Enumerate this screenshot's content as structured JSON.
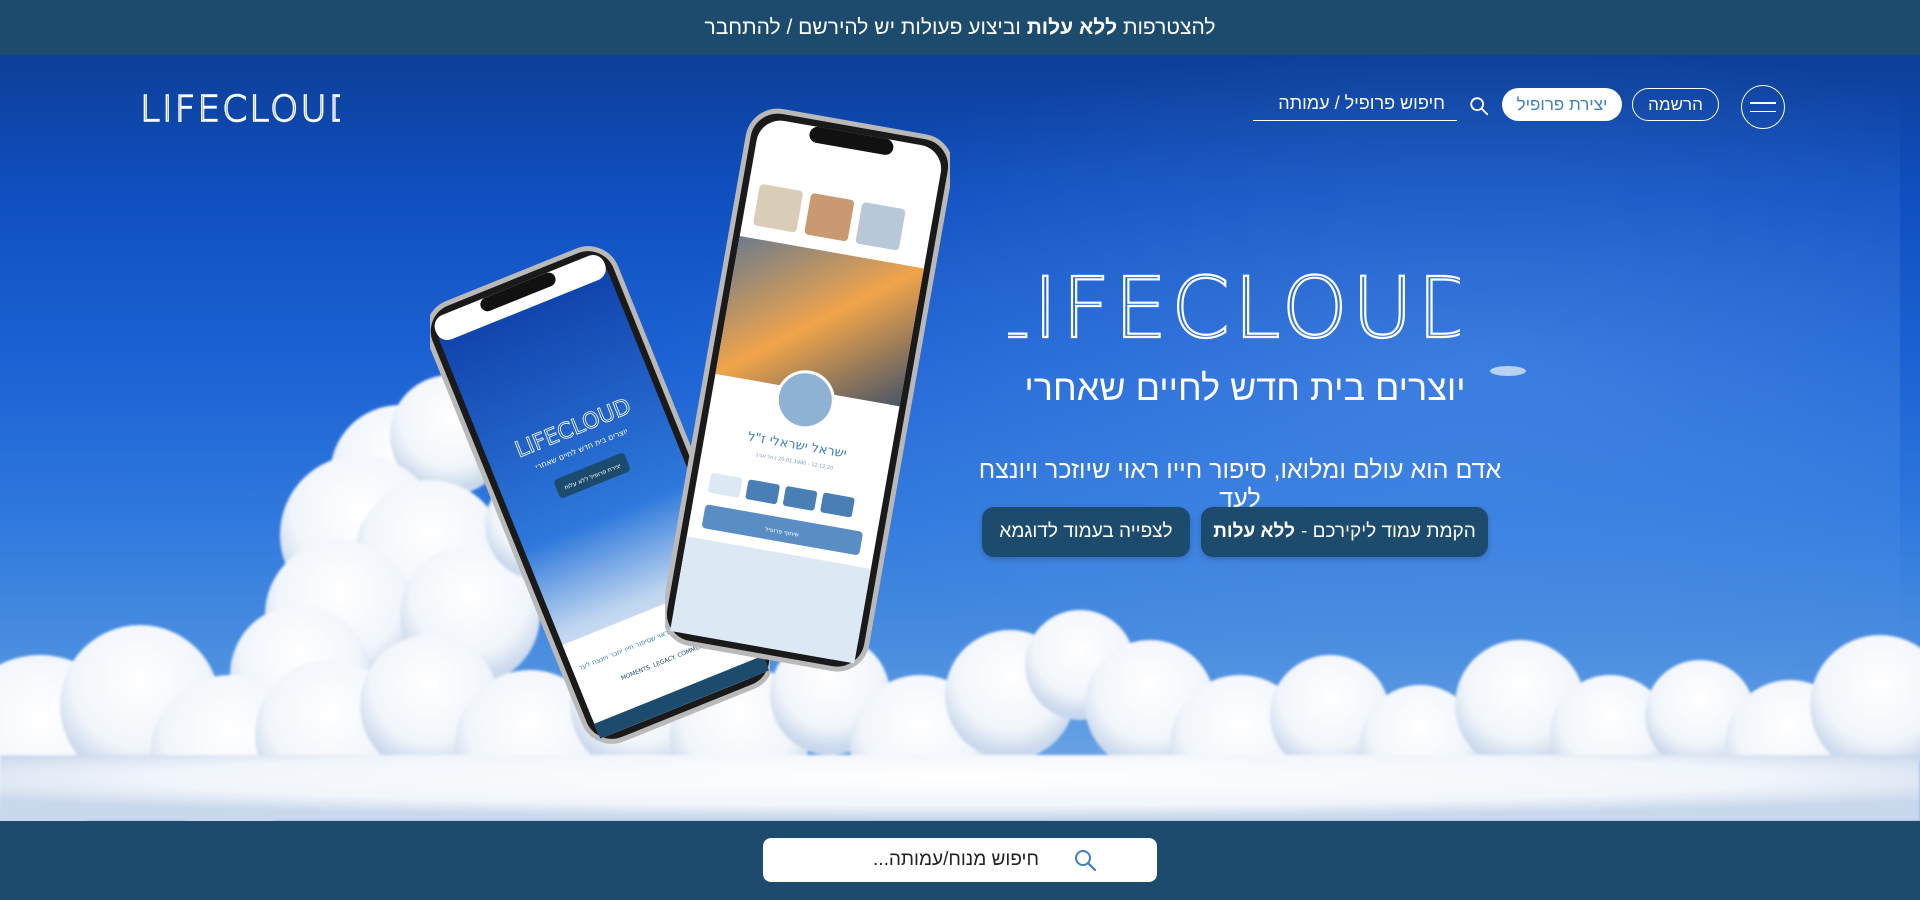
{
  "announcement": {
    "text_before": "להצטרפות",
    "text_bold": "ללא עלות",
    "text_after": "וביצוע פעולות יש להירשם / להתחבר"
  },
  "header": {
    "logo_text": "LIFECLOUD",
    "search_placeholder": "חיפוש פרופיל / עמותה",
    "create_profile_label": "יצירת פרופיל",
    "register_label": "הרשמה"
  },
  "hero": {
    "logo_text": "LIFECLOUD",
    "tagline": "יוצרים בית חדש לחיים שאחרי",
    "subtext": "אדם הוא עולם ומלואו, סיפור חייו ראוי שיוזכר ויונצח לעד",
    "cta_primary_text": "הקמת עמוד ליקירכם -",
    "cta_primary_bold": "ללא עלות",
    "cta_secondary_label": "לצפייה בעמוד לדוגמא"
  },
  "phones": {
    "left": {
      "logo": "LIFECLOUD",
      "tagline": "יוצרים בית חדש לחיים שאחרי",
      "button": "יצירת פרופיל ללא עלות",
      "text": "אדם הוא עולם ומלואו שראוי שסיפור חייו יוזכר ויונצח לעד",
      "footer": "MOMENTS. LEGACY. COMMUNITY"
    },
    "right": {
      "name": "ישראל ישראלי ז\"ל",
      "dates": "12.12.20 - 20.01.1980 | תל אביב",
      "button": "שיתוף פרופיל"
    }
  },
  "bottom_search": {
    "placeholder": "חיפוש מנוח/עמותה..."
  },
  "colors": {
    "bar": "#1d4b6e",
    "sky_top": "#0e3f98",
    "sky_bottom": "#7aaee6",
    "accent_text": "#3f7fbf"
  }
}
